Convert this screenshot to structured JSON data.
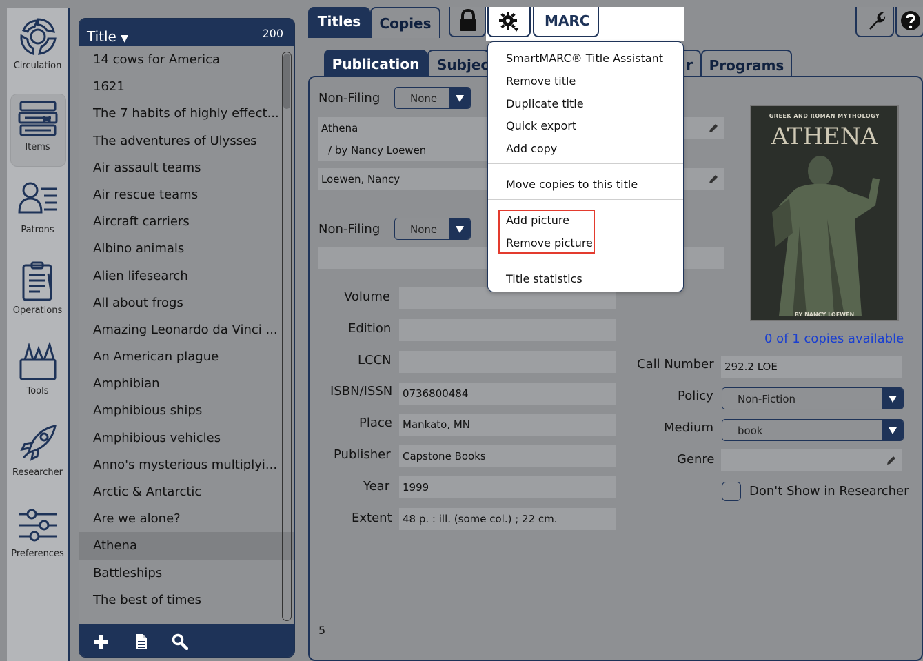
{
  "nav": {
    "items": [
      {
        "label": "Circulation",
        "icon": "circulation-icon"
      },
      {
        "label": "Items",
        "icon": "items-icon"
      },
      {
        "label": "Patrons",
        "icon": "patrons-icon"
      },
      {
        "label": "Operations",
        "icon": "operations-icon"
      },
      {
        "label": "Tools",
        "icon": "tools-icon"
      },
      {
        "label": "Researcher",
        "icon": "researcher-icon"
      },
      {
        "label": "Preferences",
        "icon": "preferences-icon"
      }
    ]
  },
  "list": {
    "header_label": "Title",
    "count": "200",
    "rows": [
      "14 cows for America",
      "1621",
      "The 7 habits of highly effect...",
      "The adventures of Ulysses",
      "Air assault teams",
      "Air rescue teams",
      "Aircraft carriers",
      "Albino animals",
      "Alien lifesearch",
      "All about frogs",
      "Amazing Leonardo da Vinci ...",
      "An American plague",
      "Amphibian",
      "Amphibious ships",
      "Amphibious vehicles",
      "Anno's mysterious multiplyi...",
      "Arctic & Antarctic",
      "Are we alone?",
      "Athena",
      "Battleships",
      "The best of times"
    ],
    "selected": "Athena"
  },
  "top_tabs": {
    "titles": "Titles",
    "copies": "Copies",
    "marc": "MARC"
  },
  "sub_tabs": {
    "publication": "Publication",
    "subject": "Subjec",
    "other": "r",
    "programs": "Programs"
  },
  "form": {
    "nonfiling_label": "Non-Filing",
    "nonfiling_value": "None",
    "title": "Athena",
    "responsibility": "/ by Nancy Loewen",
    "author": "Loewen, Nancy",
    "nonfiling2_label": "Non-Filing",
    "nonfiling2_value": "None",
    "volume_label": "Volume",
    "edition_label": "Edition",
    "lccn_label": "LCCN",
    "isbn_label": "ISBN/ISSN",
    "isbn": "0736800484",
    "place_label": "Place",
    "place": "Mankato, MN",
    "publisher_label": "Publisher",
    "publisher": "Capstone Books",
    "year_label": "Year",
    "year": "1999",
    "extent_label": "Extent",
    "extent": "48 p. : ill. (some col.) ; 22 cm.",
    "page_number": "5"
  },
  "right": {
    "copies_available": "0 of 1 copies available",
    "call_number_label": "Call Number",
    "call_number": "292.2 LOE",
    "policy_label": "Policy",
    "policy": "Non-Fiction",
    "medium_label": "Medium",
    "medium": "book",
    "genre_label": "Genre",
    "dont_show_label": "Don't Show in Researcher",
    "cover_top": "GREEK AND ROMAN MYTHOLOGY",
    "cover_title": "ATHENA",
    "cover_bottom": "BY NANCY LOEWEN"
  },
  "menu": {
    "items": [
      "SmartMARC® Title Assistant",
      "Remove title",
      "Duplicate title",
      "Quick export",
      "Add copy",
      "Move copies to this title",
      "Add picture",
      "Remove picture",
      "Title statistics"
    ]
  },
  "colors": {
    "navy": "#1e3358",
    "highlight": "#e33b2e",
    "link_blue": "#1a3fd0"
  }
}
